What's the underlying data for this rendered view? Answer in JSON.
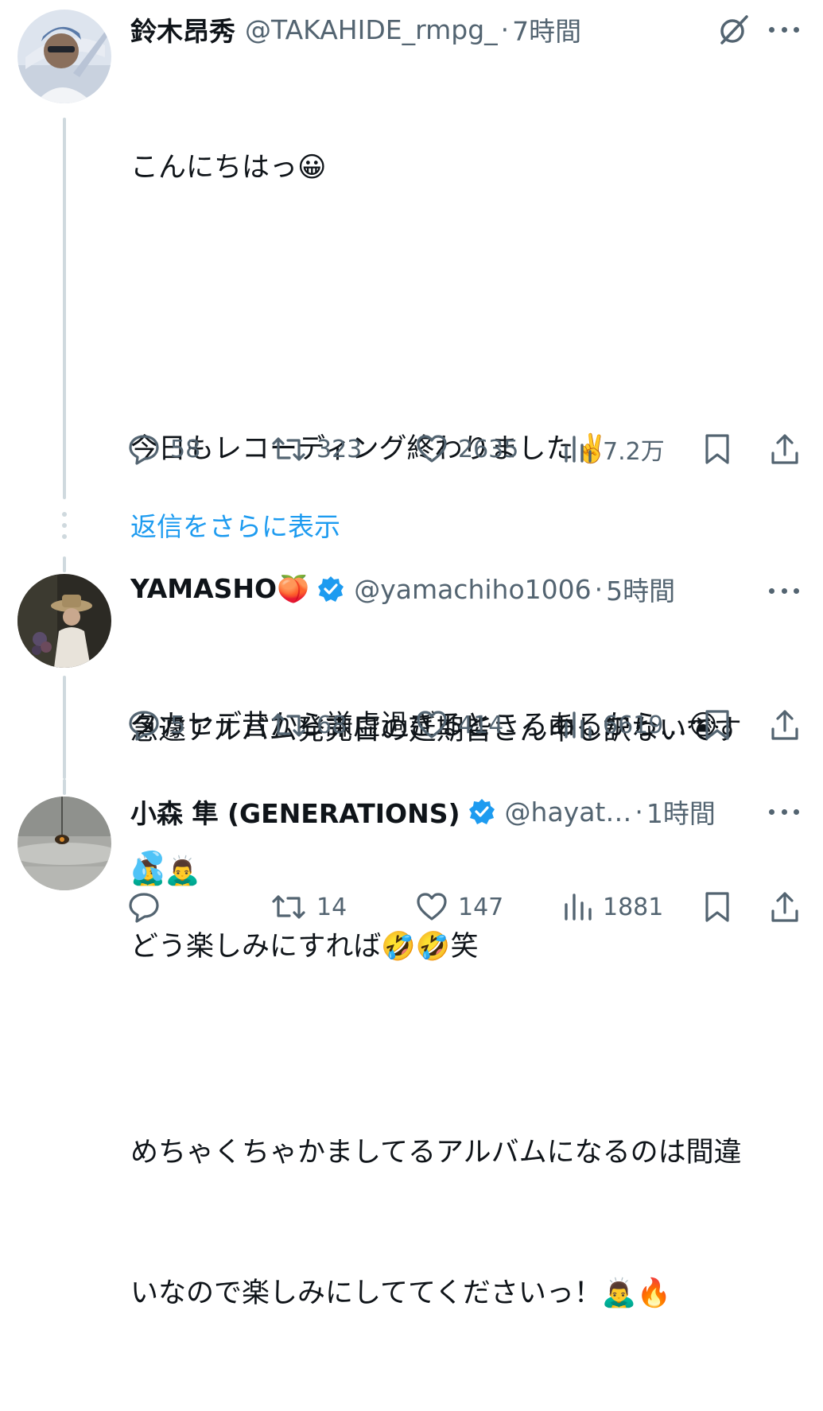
{
  "tweets": [
    {
      "name": "鈴木昂秀",
      "handle": "@TAKAHIDE_rmpg_",
      "separator": "·",
      "time": "7時間",
      "text_lines": [
        "こんにちはっ😀",
        "",
        "今日もレコーディング終わりました✌️",
        "",
        "急遽アルバム発売日の延期皆さん申し訳ないです",
        "🙇‍♂️🙇‍♂️",
        "",
        "めちゃくちゃかましてるアルバムになるのは間違",
        "いなので楽しみにしててくださいっ！🙇‍♂️🔥"
      ],
      "stats": {
        "replies": "58",
        "retweets": "323",
        "likes": "2635",
        "views": "7.2万"
      }
    },
    {
      "name": "YAMASHO🍑",
      "handle": "@yamachiho1006",
      "separator": "·",
      "time": "5時間",
      "verified": true,
      "text_lines": [
        "タカヒデ昔から謙虚過ぎるところあるから…😭",
        "💦"
      ],
      "stats": {
        "replies": "5",
        "retweets": "68",
        "likes": "414",
        "views": "6619"
      }
    },
    {
      "name": "小森 隼 (GENERATIONS)",
      "handle": "@hayat…",
      "separator": "·",
      "time": "1時間",
      "verified": true,
      "text_lines": [
        "どう楽しみにすれば🤣🤣笑"
      ],
      "stats": {
        "replies": "",
        "retweets": "14",
        "likes": "147",
        "views": "1881"
      }
    }
  ],
  "show_more_replies": "返信をさらに表示",
  "colors": {
    "text": "#0f1419",
    "secondary": "#536471",
    "accent": "#1d9bf0",
    "thread_line": "#cfd9de"
  },
  "icons": {
    "reply": "speech-bubble-icon",
    "retweet": "retweet-arrows-icon",
    "like": "heart-icon",
    "views": "bar-chart-icon",
    "bookmark": "bookmark-icon",
    "share": "share-upload-icon",
    "more": "ellipsis-icon",
    "grok": "grok-slash-icon",
    "verified": "verified-badge-icon"
  }
}
